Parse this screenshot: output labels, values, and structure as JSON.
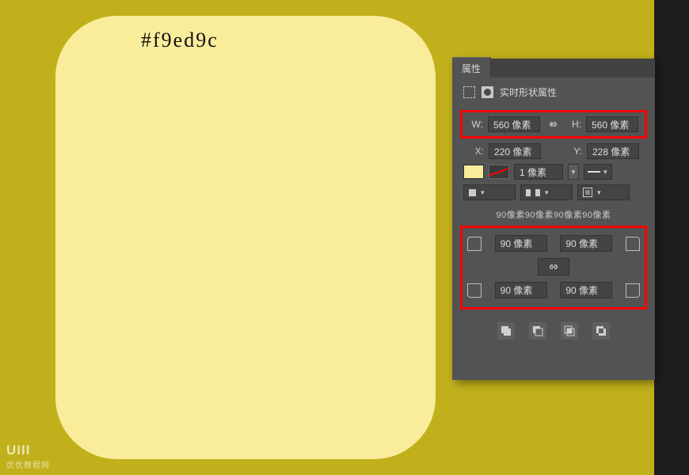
{
  "canvas": {
    "hex_label": "#f9ed9c",
    "shape_fill": "#f9ed9c"
  },
  "panel": {
    "tab_label": "属性",
    "subheader_label": "实时形状属性",
    "size": {
      "w_label": "W:",
      "w_value": "560 像素",
      "h_label": "H:",
      "h_value": "560 像素"
    },
    "position": {
      "x_label": "X:",
      "x_value": "220 像素",
      "y_label": "Y:",
      "y_value": "228 像素"
    },
    "stroke_width": "1 像素",
    "corner_summary": "90像素90像素90像素90像素",
    "corners": {
      "tl": "90 像素",
      "tr": "90 像素",
      "bl": "90 像素",
      "br": "90 像素"
    }
  },
  "watermark": {
    "brand": "UIII",
    "tagline": "优优教程网"
  }
}
